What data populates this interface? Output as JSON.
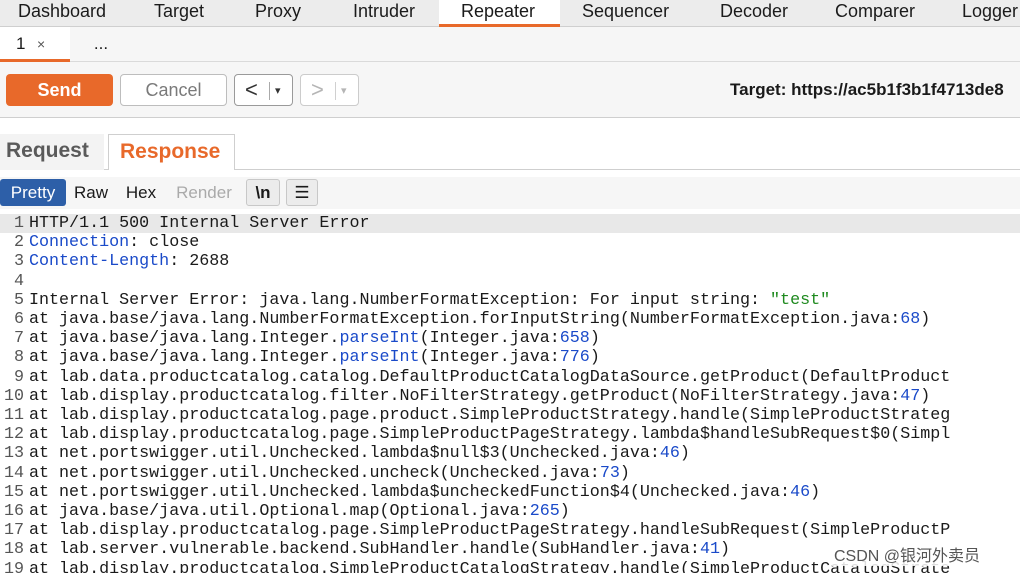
{
  "tool_tabs": [
    "Dashboard",
    "Target",
    "Proxy",
    "Intruder",
    "Repeater",
    "Sequencer",
    "Decoder",
    "Comparer",
    "Logger"
  ],
  "sub_tabs": {
    "tab1": "1",
    "close": "×",
    "more": "..."
  },
  "toolbar": {
    "send": "Send",
    "cancel": "Cancel",
    "back": "<",
    "forward": ">",
    "dropdown": "▾",
    "target": "Target: https://ac5b1f3b1f4713de8"
  },
  "panel_tabs": {
    "request": "Request",
    "response": "Response"
  },
  "modes": {
    "pretty": "Pretty",
    "raw": "Raw",
    "hex": "Hex",
    "render": "Render",
    "newline": "\\n",
    "menu": "☰"
  },
  "colors": {
    "accent": "#e8692a",
    "pretty_active": "#2d5fa8",
    "header_key": "#1a4ac9",
    "string": "#1f8a1f"
  },
  "response_lines": [
    [
      {
        "t": "HTTP/1.1 500 Internal Server Error"
      }
    ],
    [
      {
        "t": "Connection",
        "c": "hk"
      },
      {
        "t": ": close"
      }
    ],
    [
      {
        "t": "Content-Length",
        "c": "hk"
      },
      {
        "t": ": 2688"
      }
    ],
    [
      {
        "t": ""
      }
    ],
    [
      {
        "t": "Internal Server Error: java.lang.NumberFormatException: For input string: "
      },
      {
        "t": "\"test\"",
        "c": "str"
      }
    ],
    [
      {
        "t": "at java.base/java.lang.NumberFormatException.forInputString(NumberFormatException.java:"
      },
      {
        "t": "68",
        "c": "num"
      },
      {
        "t": ")"
      }
    ],
    [
      {
        "t": "at java.base/java.lang.Integer."
      },
      {
        "t": "parseInt",
        "c": "hk"
      },
      {
        "t": "(Integer.java:"
      },
      {
        "t": "658",
        "c": "num"
      },
      {
        "t": ")"
      }
    ],
    [
      {
        "t": "at java.base/java.lang.Integer."
      },
      {
        "t": "parseInt",
        "c": "hk"
      },
      {
        "t": "(Integer.java:"
      },
      {
        "t": "776",
        "c": "num"
      },
      {
        "t": ")"
      }
    ],
    [
      {
        "t": "at lab.data.productcatalog.catalog.DefaultProductCatalogDataSource.getProduct(DefaultProduct"
      }
    ],
    [
      {
        "t": "at lab.display.productcatalog.filter.NoFilterStrategy.getProduct(NoFilterStrategy.java:"
      },
      {
        "t": "47",
        "c": "num"
      },
      {
        "t": ")"
      }
    ],
    [
      {
        "t": "at lab.display.productcatalog.page.product.SimpleProductStrategy.handle(SimpleProductStrateg"
      }
    ],
    [
      {
        "t": "at lab.display.productcatalog.page.SimpleProductPageStrategy.lambda$handleSubRequest$0(Simpl"
      }
    ],
    [
      {
        "t": "at net.portswigger.util.Unchecked.lambda$null$3(Unchecked.java:"
      },
      {
        "t": "46",
        "c": "num"
      },
      {
        "t": ")"
      }
    ],
    [
      {
        "t": "at net.portswigger.util.Unchecked.uncheck(Unchecked.java:"
      },
      {
        "t": "73",
        "c": "num"
      },
      {
        "t": ")"
      }
    ],
    [
      {
        "t": "at net.portswigger.util.Unchecked.lambda$uncheckedFunction$4(Unchecked.java:"
      },
      {
        "t": "46",
        "c": "num"
      },
      {
        "t": ")"
      }
    ],
    [
      {
        "t": "at java.base/java.util.Optional.map(Optional.java:"
      },
      {
        "t": "265",
        "c": "num"
      },
      {
        "t": ")"
      }
    ],
    [
      {
        "t": "at lab.display.productcatalog.page.SimpleProductPageStrategy.handleSubRequest(SimpleProductP"
      }
    ],
    [
      {
        "t": "at lab.server.vulnerable.backend.SubHandler.handle(SubHandler.java:"
      },
      {
        "t": "41",
        "c": "num"
      },
      {
        "t": ")"
      }
    ],
    [
      {
        "t": "at lab.display.productcatalog.SimpleProductCatalogStrategy.handle(SimpleProductCatalogStrate"
      }
    ]
  ],
  "watermark": "CSDN @银河外卖员"
}
